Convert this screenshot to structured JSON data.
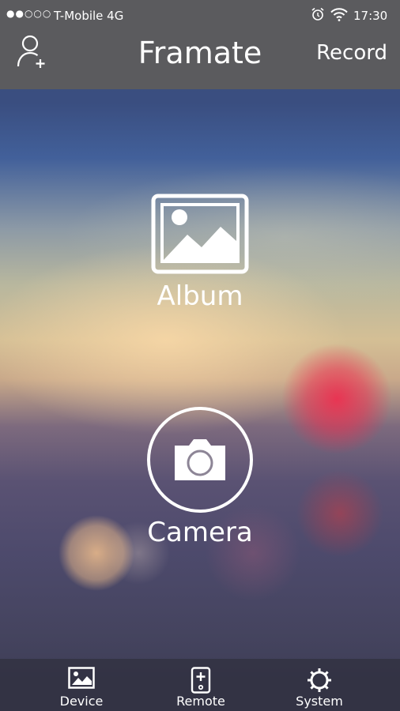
{
  "status_bar": {
    "signal": "●●○○○",
    "carrier": "T-Mobile 4G",
    "time": "17:30",
    "icons": [
      "alarm-icon",
      "wifi-icon"
    ]
  },
  "header": {
    "title": "Framate",
    "record_label": "Record",
    "left_icon": "add-user-icon"
  },
  "main": {
    "album": {
      "label": "Album",
      "icon": "image-icon"
    },
    "camera": {
      "label": "Camera",
      "icon": "camera-icon"
    }
  },
  "tab_bar": {
    "tabs": [
      {
        "label": "Device",
        "icon": "image-icon"
      },
      {
        "label": "Remote",
        "icon": "remote-icon"
      },
      {
        "label": "System",
        "icon": "gear-icon"
      }
    ]
  },
  "colors": {
    "header_bg": "#5b5b5e",
    "tab_bar_bg": "#323242",
    "foreground": "#ffffff"
  }
}
